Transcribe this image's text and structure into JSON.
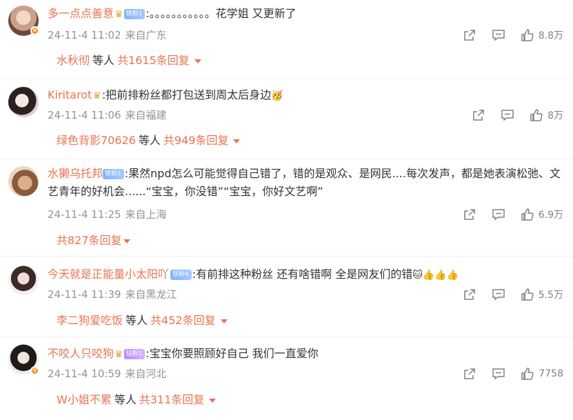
{
  "comments": [
    {
      "username": "多一点点善意",
      "fan_badge": "铁粉1",
      "text": ":。。。。。。。。。。。花学姐 又更新了",
      "emoji": "",
      "date": "24-11-4 11:02",
      "location": "来自广东",
      "likes": "8.8万",
      "reply_user": "水秋彻",
      "reply_mid": "等人",
      "reply_total": "共1615条回复"
    },
    {
      "username": "Kiritarot",
      "fan_badge": "",
      "text": ":把前排粉丝都打包送到周太后身边",
      "emoji": "🥳",
      "date": "24-11-4 11:06",
      "location": "来自福建",
      "likes": "8万",
      "reply_user": "绿色背影70626",
      "reply_mid": "等人",
      "reply_total": "共949条回复"
    },
    {
      "username": "水獭乌托邦",
      "fan_badge": "铁粉1",
      "text": ":果然npd怎么可能觉得自己错了，错的是观众、是网民....每次发声，都是她表演松弛、文艺青年的好机会......“宝宝，你没错”“宝宝，你好文艺啊”",
      "emoji": "",
      "date": "24-11-4 11:25",
      "location": "来自上海",
      "likes": "6.9万",
      "reply_user": "",
      "reply_mid": "",
      "reply_total": "共827条回复"
    },
    {
      "username": "今天就是正能量小太阳吖",
      "fan_badge": "铁粉4",
      "text": ":有前排这种粉丝 还有啥错啊 全是网友们的错",
      "emoji": "🐱👍👍👍",
      "date": "24-11-4 11:39",
      "location": "来自黑龙江",
      "likes": "5.5万",
      "reply_user": "李二狗爱吃饭",
      "reply_mid": "等人",
      "reply_total": "共452条回复"
    },
    {
      "username": "不咬人只咬狗",
      "fan_badge": "钻粉1",
      "text": ":宝宝你要照顾好自己 我们一直爱你",
      "emoji": "",
      "date": "24-11-4 10:59",
      "location": "来自河北",
      "likes": "7758",
      "reply_user": "W小姐不累",
      "reply_mid": "等人",
      "reply_total": "共311条回复"
    }
  ],
  "icons": {
    "share": "share-icon",
    "comment": "comment-icon",
    "like": "thumbs-up-icon",
    "crown": "crown-icon"
  },
  "colors": {
    "username": "#eb7350",
    "meta": "#939393",
    "text": "#333333"
  }
}
